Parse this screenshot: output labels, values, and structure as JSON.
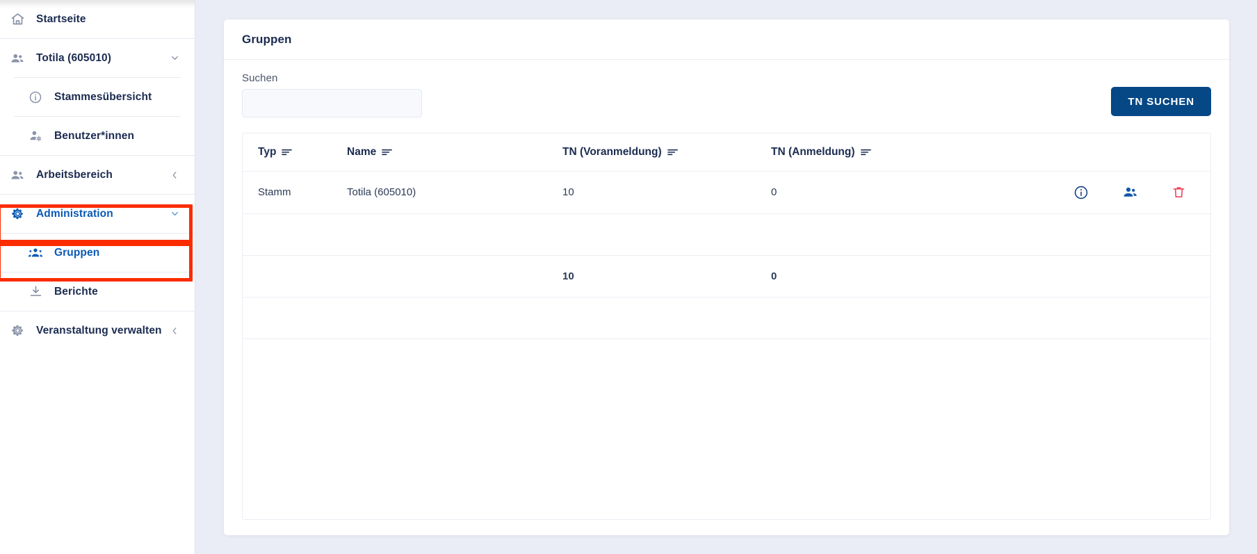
{
  "colors": {
    "accent_blue": "#0b5ab5",
    "button_blue": "#064785",
    "annotation_red": "#fb2c00",
    "trash_red": "#f0445a",
    "text_dark": "#1b2b50",
    "page_bg": "#eaedf5"
  },
  "sidebar": {
    "items": [
      {
        "label": "Startseite",
        "icon": "home-icon",
        "level": "top",
        "chevron": "",
        "active": false
      },
      {
        "label": "Totila (605010)",
        "icon": "people-icon",
        "level": "top",
        "chevron": "down",
        "active": false
      },
      {
        "label": "Stammesübersicht",
        "icon": "info-circle-icon",
        "level": "sub",
        "chevron": "",
        "active": false
      },
      {
        "label": "Benutzer*innen",
        "icon": "person-gear-icon",
        "level": "sub",
        "chevron": "",
        "active": false
      },
      {
        "label": "Arbeitsbereich",
        "icon": "people-icon",
        "level": "top",
        "chevron": "left",
        "active": false
      },
      {
        "label": "Administration",
        "icon": "gear-icon",
        "level": "top",
        "chevron": "down",
        "active": true
      },
      {
        "label": "Gruppen",
        "icon": "groups-icon",
        "level": "sub",
        "chevron": "",
        "active": true
      },
      {
        "label": "Berichte",
        "icon": "download-icon",
        "level": "sub",
        "chevron": "",
        "active": false
      },
      {
        "label": "Veranstaltung verwalten",
        "icon": "gear-icon",
        "level": "top",
        "chevron": "left",
        "active": false
      }
    ]
  },
  "main": {
    "card_title": "Gruppen",
    "search": {
      "label": "Suchen",
      "value": "",
      "placeholder": ""
    },
    "search_button_label": "TN SUCHEN",
    "table": {
      "columns": [
        {
          "label": "Typ",
          "sort_icon": "sort-icon"
        },
        {
          "label": "Name",
          "sort_icon": "sort-icon"
        },
        {
          "label": "TN (Voranmeldung)",
          "sort_icon": "sort-icon"
        },
        {
          "label": "TN (Anmeldung)",
          "sort_icon": "sort-icon"
        }
      ],
      "rows": [
        {
          "typ": "Stamm",
          "name": "Totila (605010)",
          "tn_voranmeldung": "10",
          "tn_anmeldung": "0",
          "actions": [
            {
              "name": "info-icon",
              "title": "Info"
            },
            {
              "name": "members-icon",
              "title": "Teilnehmer"
            },
            {
              "name": "delete-icon",
              "title": "Löschen"
            }
          ]
        }
      ],
      "totals": {
        "typ": "",
        "name": "",
        "tn_voranmeldung": "10",
        "tn_anmeldung": "0"
      }
    }
  }
}
